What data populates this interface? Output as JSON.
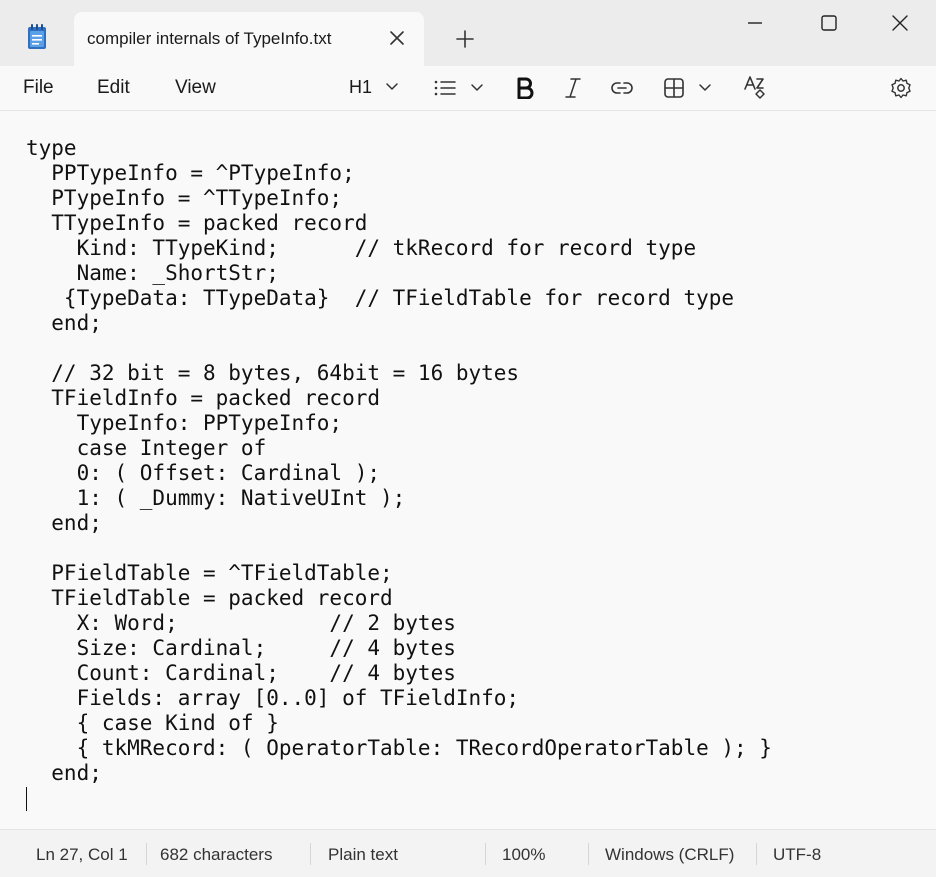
{
  "window": {
    "tab_title": "compiler internals of TypeInfo.txt"
  },
  "menu": {
    "file": "File",
    "edit": "Edit",
    "view": "View"
  },
  "toolbar": {
    "heading": "H1",
    "icons": [
      "list-icon",
      "bold-icon",
      "italic-icon",
      "link-icon",
      "table-icon",
      "spellcheck-icon",
      "settings-icon"
    ]
  },
  "editor": {
    "lines": [
      "type",
      "  PPTypeInfo = ^PTypeInfo;",
      "  PTypeInfo = ^TTypeInfo;",
      "  TTypeInfo = packed record",
      "    Kind: TTypeKind;      // tkRecord for record type",
      "    Name: _ShortStr;",
      "   {TypeData: TTypeData}  // TFieldTable for record type",
      "  end;",
      "",
      "  // 32 bit = 8 bytes, 64bit = 16 bytes",
      "  TFieldInfo = packed record",
      "    TypeInfo: PPTypeInfo;",
      "    case Integer of",
      "    0: ( Offset: Cardinal );",
      "    1: ( _Dummy: NativeUInt );",
      "  end;",
      "",
      "  PFieldTable = ^TFieldTable;",
      "  TFieldTable = packed record",
      "    X: Word;            // 2 bytes",
      "    Size: Cardinal;     // 4 bytes",
      "    Count: Cardinal;    // 4 bytes",
      "    Fields: array [0..0] of TFieldInfo;",
      "    { case Kind of }",
      "    { tkMRecord: ( OperatorTable: TRecordOperatorTable ); }",
      "  end;",
      ""
    ]
  },
  "status": {
    "position": "Ln 27, Col 1",
    "characters": "682 characters",
    "format": "Plain text",
    "zoom": "100%",
    "line_ending": "Windows (CRLF)",
    "encoding": "UTF-8"
  },
  "colors": {
    "titlebar": "#ececec",
    "editor_bg": "#f9f9f9",
    "app_icon": "#2f6fc1"
  }
}
